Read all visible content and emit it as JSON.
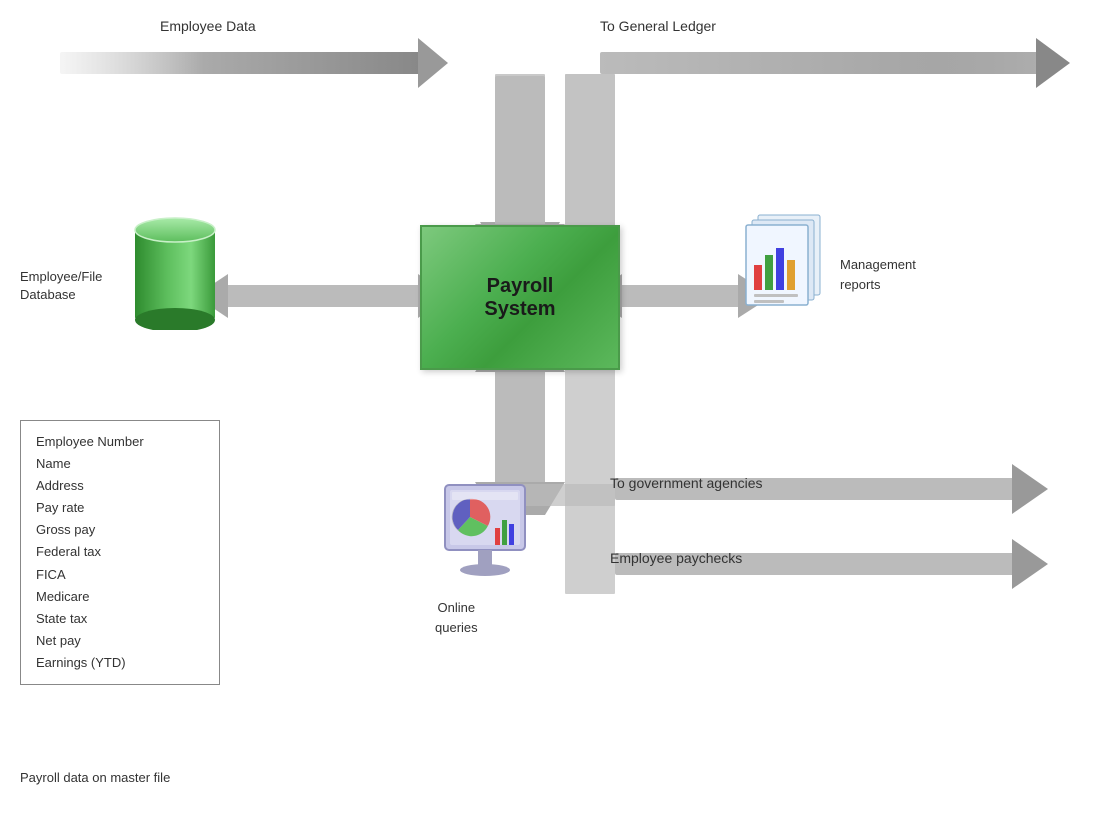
{
  "labels": {
    "employee_data": "Employee Data",
    "general_ledger": "To General Ledger",
    "payroll_system": "Payroll\nSystem",
    "payroll_system_line1": "Payroll",
    "payroll_system_line2": "System",
    "employee_file_database_line1": "Employee/File",
    "employee_file_database_line2": "Database",
    "management_reports_line1": "Management",
    "management_reports_line2": "reports",
    "online_queries_line1": "Online",
    "online_queries_line2": "queries",
    "gov_agencies": "To government agencies",
    "employee_paychecks": "Employee paychecks",
    "payroll_data": "Payroll data on master file"
  },
  "info_box": {
    "items": [
      "Employee Number",
      "Name",
      "Address",
      "Pay rate",
      "Gross pay",
      "Federal tax",
      "FICA",
      "Medicare",
      "State tax",
      "Net pay",
      "Earnings (YTD)"
    ]
  }
}
